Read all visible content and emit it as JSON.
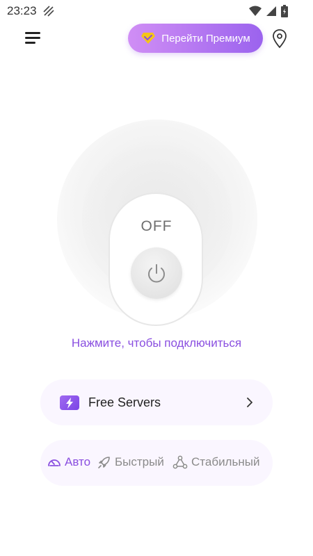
{
  "status_bar": {
    "time": "23:23"
  },
  "header": {
    "premium_label": "Перейти Премиум"
  },
  "power": {
    "state_label": "OFF",
    "hint": "Нажмите, чтобы подключиться"
  },
  "servers": {
    "label": "Free Servers"
  },
  "modes": [
    {
      "label": "Авто",
      "icon": "speedometer-icon",
      "active": true
    },
    {
      "label": "Быстрый",
      "icon": "rocket-icon",
      "active": false
    },
    {
      "label": "Стабильный",
      "icon": "triangle-nodes-icon",
      "active": false
    }
  ],
  "colors": {
    "accent": "#8a4fe0",
    "premium_start": "#d08ef5",
    "premium_end": "#9b63ee",
    "badge": "#f5c518"
  }
}
